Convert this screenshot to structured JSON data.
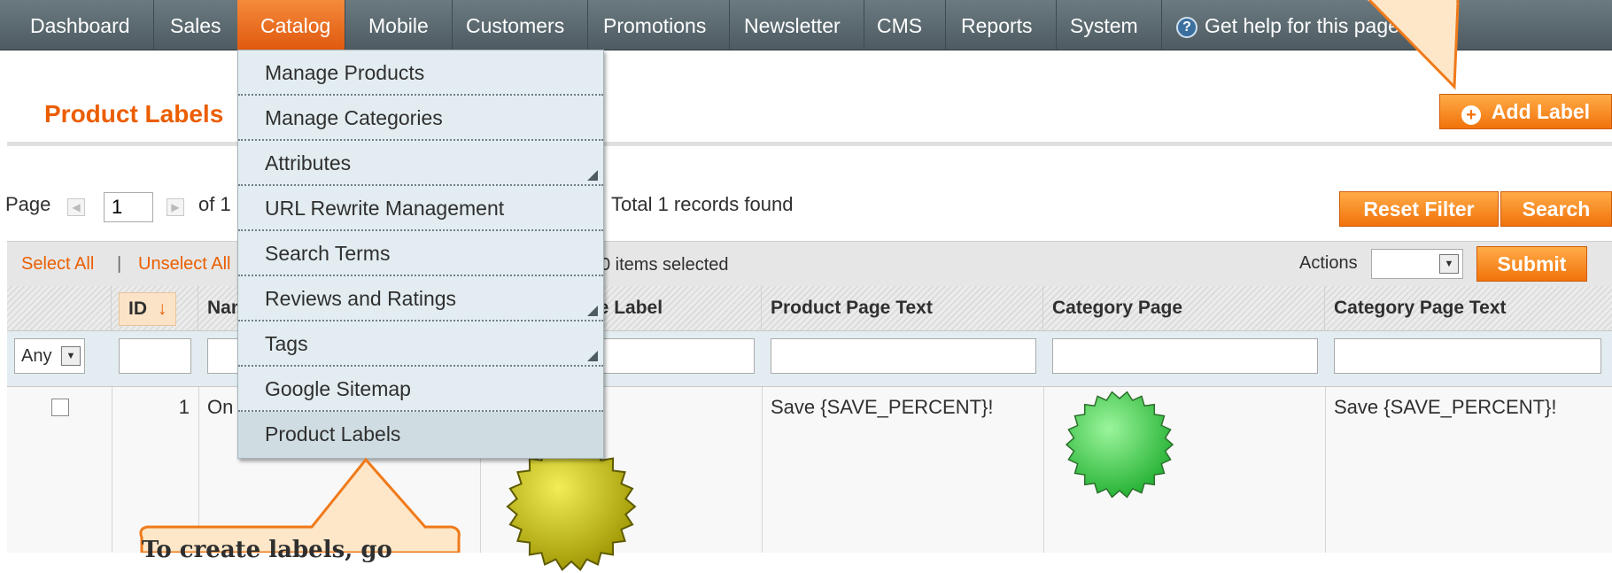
{
  "nav": {
    "items": [
      "Dashboard",
      "Sales",
      "Catalog",
      "Mobile",
      "Customers",
      "Promotions",
      "Newsletter",
      "CMS",
      "Reports",
      "System"
    ],
    "active": "Catalog",
    "help_label": "Get help for this page"
  },
  "catalog_menu": {
    "items": [
      "Manage Products",
      "Manage Categories",
      "Attributes",
      "URL Rewrite Management",
      "Search Terms",
      "Reviews and Ratings",
      "Tags",
      "Google Sitemap",
      "Product Labels"
    ],
    "highlighted": "Product Labels"
  },
  "page": {
    "title": "Product Labels",
    "add_button": "Add Label"
  },
  "pager": {
    "page_label": "Page",
    "current_page": "1",
    "of_pages": "of 1 pages",
    "total": "Total 1 records found"
  },
  "grid_buttons": {
    "reset_filter": "Reset Filter",
    "search": "Search"
  },
  "massaction": {
    "select_all": "Select All",
    "unselect_all": "Unselect All",
    "items_selected": "0 items selected",
    "actions_label": "Actions",
    "submit": "Submit"
  },
  "columns": [
    "ID",
    "Name",
    "Product Page Label",
    "Product Page Text",
    "Category Page",
    "Category Page Text"
  ],
  "filter": {
    "any": "Any"
  },
  "rows": [
    {
      "id": "1",
      "name": "On sale",
      "product_page_label_icon": "yellow-starburst-icon",
      "product_page_text": "Save {SAVE_PERCENT}!",
      "category_page_icon": "green-starburst-icon",
      "category_page_text": "Save {SAVE_PERCENT}!"
    }
  ],
  "callout": {
    "text": "To create labels, go"
  },
  "colors": {
    "accent": "#eb5e00",
    "nav": "#55646a",
    "yellow_badge": "#d8d000",
    "green_badge": "#3fcf3f"
  }
}
